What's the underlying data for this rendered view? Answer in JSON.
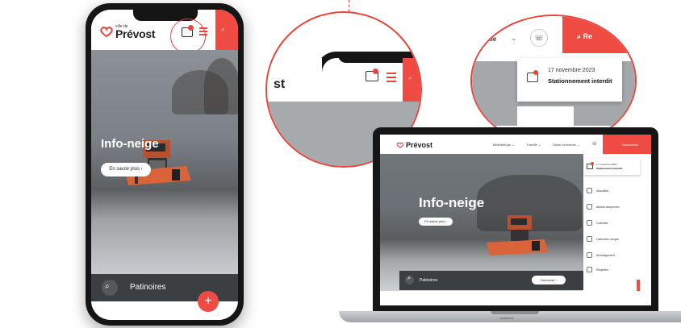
{
  "phone": {
    "logo_small": "ville de",
    "logo_text": "Prévost",
    "hero_title": "Info-neige",
    "hero_button": "En savoir plus  ›",
    "bottom_search_label": "Patinoires",
    "fab_symbol": "+"
  },
  "zoom_phone": {
    "logo_fragment": "st"
  },
  "zoom_desktop": {
    "select_text": "isme",
    "search_label": "Re",
    "notice_date": "17 novembre 2023",
    "notice_subject": "Stationnement interdit"
  },
  "laptop": {
    "logo_text": "Prévost",
    "nav": [
      "Bibliothèque  ⌄",
      "Famille  ⌄",
      "Saine économie  ⌄"
    ],
    "red_label": "Rechercher",
    "hero_title": "Info-neige",
    "hero_button": "En savoir plus  ›",
    "bottom_search_label": "Patinoires",
    "bottom_button": "Découvrir  ›",
    "side_notice_date": "17 novembre 2023",
    "side_notice_subject": "Stationnement interdit",
    "side_items": [
      "Actualités",
      "Alertes citoyennes",
      "Collectes",
      "Calendrier citoyen",
      "Aménagement",
      "Requêtes"
    ],
    "brand": "MacBook"
  },
  "colors": {
    "accent": "#ef4b43",
    "dark": "#151515",
    "bar": "#3c3f42"
  }
}
